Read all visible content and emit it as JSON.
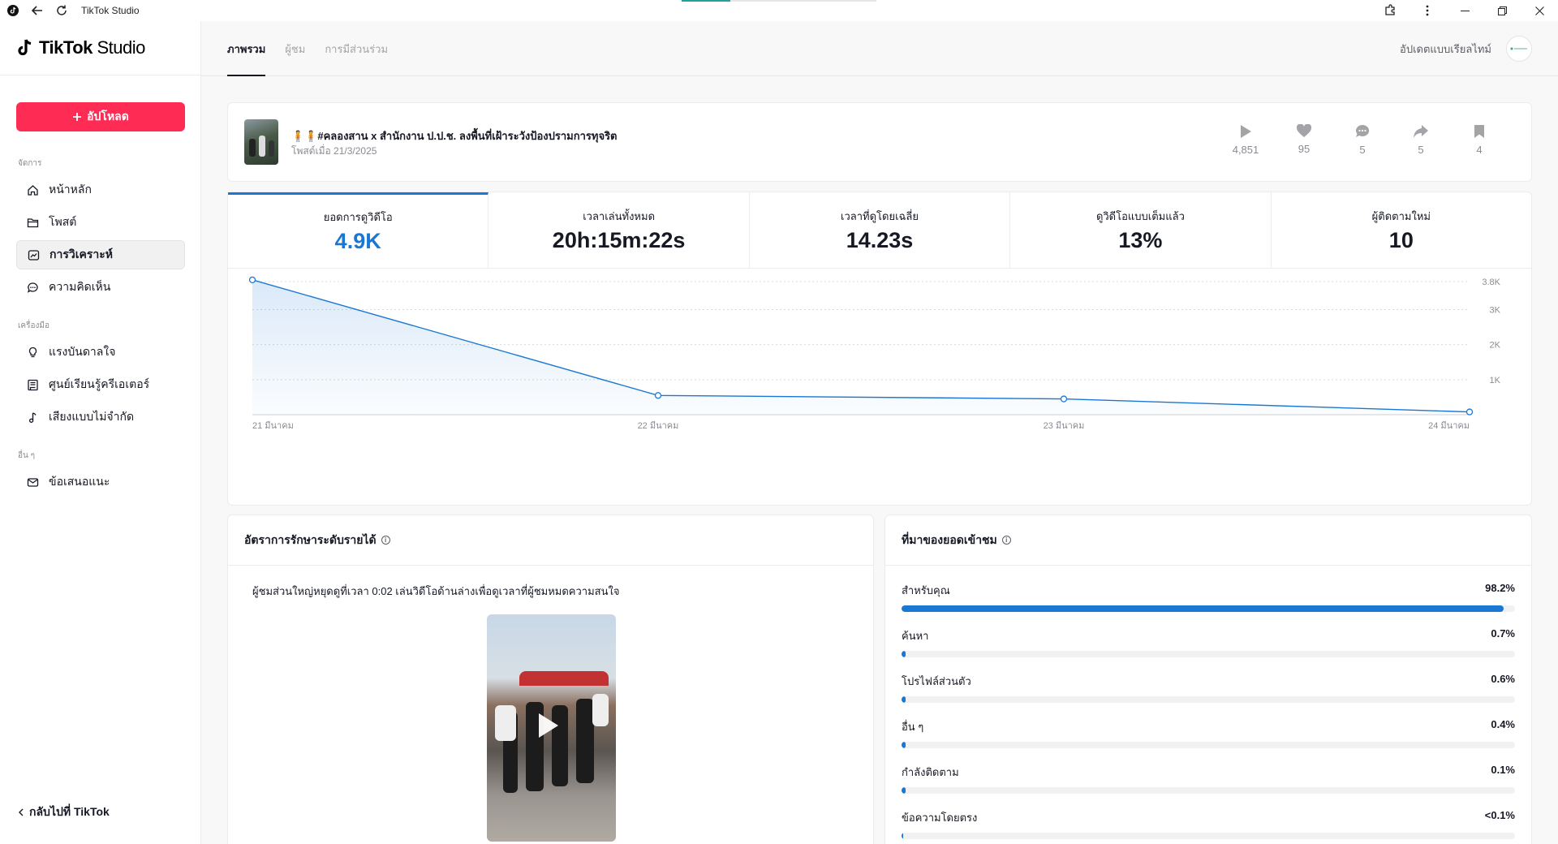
{
  "window": {
    "title": "TikTok Studio",
    "progress": 0.25
  },
  "brand": {
    "name": "TikTok",
    "suffix": "Studio"
  },
  "sidebar": {
    "upload_label": "อัปโหลด",
    "section_manage": "จัดการ",
    "items_manage": [
      {
        "label": "หน้าหลัก",
        "icon": "home-icon"
      },
      {
        "label": "โพสต์",
        "icon": "folder-icon"
      },
      {
        "label": "การวิเคราะห์",
        "icon": "analytics-icon",
        "active": true
      },
      {
        "label": "ความคิดเห็น",
        "icon": "comment-icon"
      }
    ],
    "section_tools": "เครื่องมือ",
    "items_tools": [
      {
        "label": "แรงบันดาลใจ",
        "icon": "lightbulb-icon"
      },
      {
        "label": "ศูนย์เรียนรู้ครีเอเตอร์",
        "icon": "book-icon"
      },
      {
        "label": "เสียงแบบไม่จำกัด",
        "icon": "music-note-icon"
      }
    ],
    "section_other": "อื่น ๆ",
    "items_other": [
      {
        "label": "ข้อเสนอแนะ",
        "icon": "mail-icon"
      }
    ],
    "back_label": "กลับไปที่ TikTok"
  },
  "topnav": {
    "tabs": [
      "ภาพรวม",
      "ผู้ชม",
      "การมีส่วนร่วม"
    ],
    "active_tab": 0,
    "realtime_label": "อัปเดตแบบเรียลไทม์"
  },
  "video": {
    "title": "🧍🧍#คลองสาน x สำนักงาน ป.ป.ช. ลงพื้นที่เฝ้าระวังป้องปรามการทุจริต",
    "date": "โพสต์เมื่อ 21/3/2025",
    "stats": {
      "views": "4,851",
      "likes": "95",
      "comments": "5",
      "shares": "5",
      "saves": "4"
    }
  },
  "metrics": [
    {
      "label": "ยอดการดูวิดีโอ",
      "value": "4.9K"
    },
    {
      "label": "เวลาเล่นทั้งหมด",
      "value": "20h:15m:22s"
    },
    {
      "label": "เวลาที่ดูโดยเฉลี่ย",
      "value": "14.23s"
    },
    {
      "label": "ดูวิดีโอแบบเต็มแล้ว",
      "value": "13%"
    },
    {
      "label": "ผู้ติดตามใหม่",
      "value": "10"
    }
  ],
  "chart_data": {
    "type": "area",
    "categories": [
      "21 มีนาคม",
      "22 มีนาคม",
      "23 มีนาคม",
      "24 มีนาคม"
    ],
    "values": [
      3850,
      550,
      450,
      80
    ],
    "yticks": [
      1000,
      2000,
      3000,
      3800
    ],
    "ytick_labels": [
      "1K",
      "2K",
      "3K",
      "3.8K"
    ],
    "ylim": [
      0,
      3800
    ],
    "color": "#1b77d4",
    "grid": true
  },
  "retention": {
    "title": "อัตราการรักษาระดับรายได้",
    "text": "ผู้ชมส่วนใหญ่หยุดดูที่เวลา 0:02 เล่นวิดีโอด้านล่างเพื่อดูเวลาที่ผู้ชมหมดความสนใจ"
  },
  "sources": {
    "title": "ที่มาของยอดเข้าชม",
    "items": [
      {
        "label": "สำหรับคุณ",
        "value": "98.2%",
        "pct": 98.2
      },
      {
        "label": "ค้นหา",
        "value": "0.7%",
        "pct": 0.7
      },
      {
        "label": "โปรไฟล์ส่วนตัว",
        "value": "0.6%",
        "pct": 0.6
      },
      {
        "label": "อื่น ๆ",
        "value": "0.4%",
        "pct": 0.4
      },
      {
        "label": "กำลังติดตาม",
        "value": "0.1%",
        "pct": 0.1
      },
      {
        "label": "ข้อความโดยตรง",
        "value": "<0.1%",
        "pct": 0.0
      }
    ]
  }
}
